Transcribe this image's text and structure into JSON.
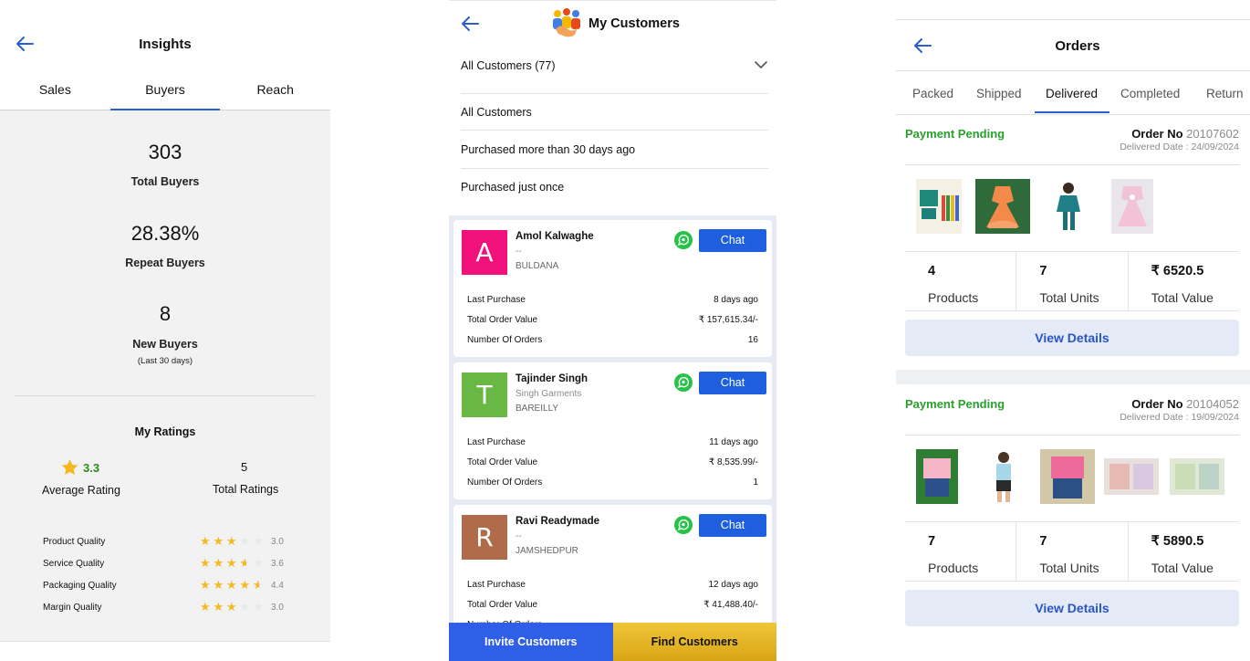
{
  "insights": {
    "title": "Insights",
    "tabs": [
      "Sales",
      "Buyers",
      "Reach"
    ],
    "active_tab": "Buyers",
    "total_buyers": {
      "value": "303",
      "label": "Total Buyers"
    },
    "repeat_buyers": {
      "value": "28.38%",
      "label": "Repeat Buyers"
    },
    "new_buyers": {
      "value": "8",
      "label": "New Buyers",
      "sublabel": "(Last 30 days)"
    },
    "ratings": {
      "title": "My Ratings",
      "average_value": "3.3",
      "average_label": "Average Rating",
      "total_value": "5",
      "total_label": "Total Ratings",
      "star_color": "#f7b81f",
      "qualities": [
        {
          "label": "Product Quality",
          "rating": 3.0,
          "value": "3.0"
        },
        {
          "label": "Service Quality",
          "rating": 3.6,
          "value": "3.6"
        },
        {
          "label": "Packaging Quality",
          "rating": 4.4,
          "value": "4.4"
        },
        {
          "label": "Margin Quality",
          "rating": 3.0,
          "value": "3.0"
        }
      ]
    }
  },
  "customers": {
    "title": "My Customers",
    "dropdown_value": "All Customers (77)",
    "options": [
      "All Customers",
      "Purchased more than 30 days ago",
      "Purchased just once"
    ],
    "chat_label": "Chat",
    "row_labels": {
      "last_purchase": "Last Purchase",
      "total_order_value": "Total Order Value",
      "number_of_orders": "Number Of Orders"
    },
    "list": [
      {
        "initial": "A",
        "avatar_color": "#f0127a",
        "name": "Amol Kalwaghe",
        "business": "--",
        "city": "BULDANA",
        "last_purchase": "8 days ago",
        "total_order_value": "₹ 157,615.34/-",
        "number_of_orders": "16"
      },
      {
        "initial": "T",
        "avatar_color": "#6ab844",
        "name": "Tajinder Singh",
        "business": "Singh Garments",
        "city": "BAREILLY",
        "last_purchase": "11 days ago",
        "total_order_value": "₹ 8,535.99/-",
        "number_of_orders": "1"
      },
      {
        "initial": "R",
        "avatar_color": "#b06c4a",
        "name": "Ravi Readymade",
        "business": "--",
        "city": "JAMSHEDPUR",
        "last_purchase": "12 days ago",
        "total_order_value": "₹ 41,488.40/-",
        "number_of_orders": ""
      }
    ],
    "invite_label": "Invite Customers",
    "find_label": "Find Customers"
  },
  "orders": {
    "title": "Orders",
    "tabs": [
      "Packed",
      "Shipped",
      "Delivered",
      "Completed",
      "Return"
    ],
    "active_tab": "Delivered",
    "order_no_label": "Order No",
    "delivered_label": "Delivered Date :",
    "products_label": "Products",
    "units_label": "Total Units",
    "value_label": "Total Value",
    "view_label": "View Details",
    "list": [
      {
        "status": "Payment Pending",
        "order_no": "20107602",
        "delivered_date": "24/09/2024",
        "products": "4",
        "units": "7",
        "value": "₹ 6520.5"
      },
      {
        "status": "Payment Pending",
        "order_no": "20104052",
        "delivered_date": "19/09/2024",
        "products": "7",
        "units": "7",
        "value": "₹ 5890.5"
      }
    ]
  }
}
